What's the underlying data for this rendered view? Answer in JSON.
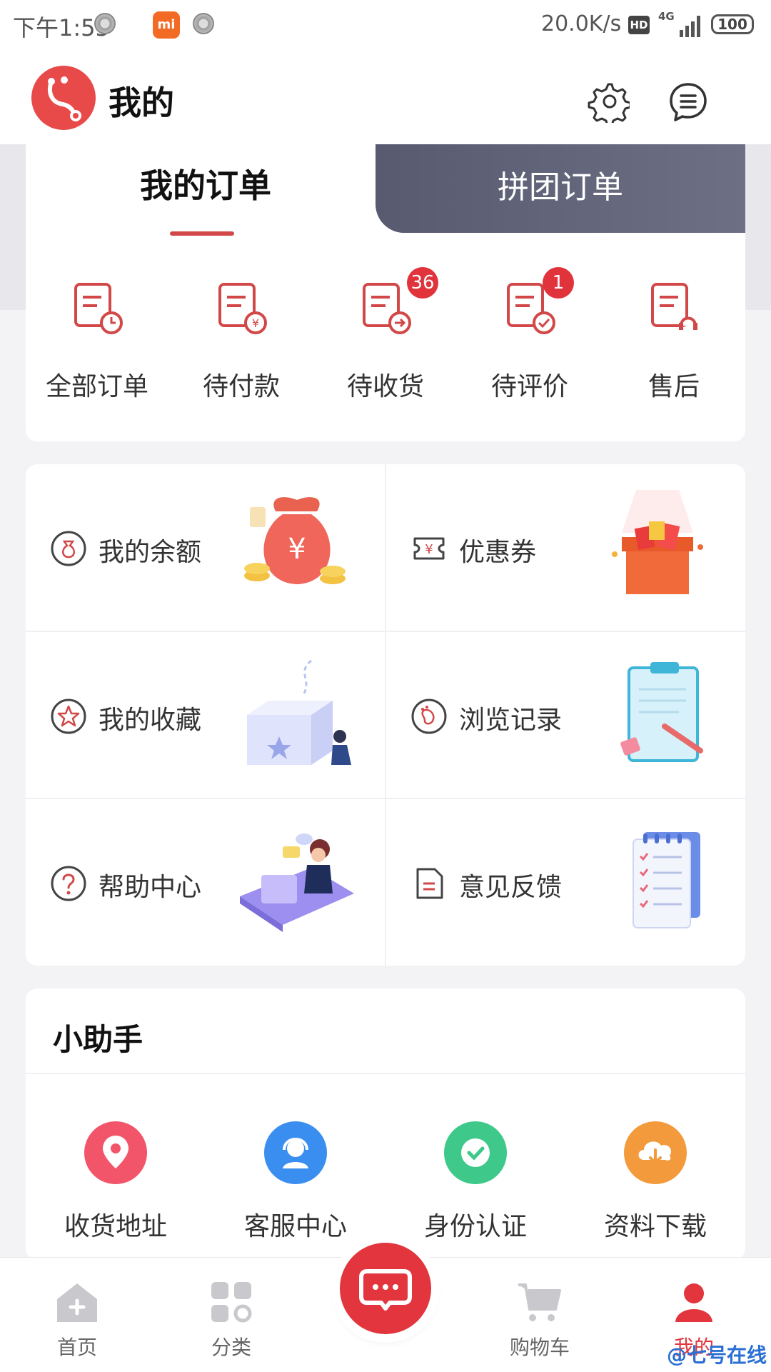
{
  "status_bar": {
    "time": "下午1:55",
    "network_speed": "20.0K/s",
    "hd": "HD",
    "signal_label": "4G",
    "battery": "100",
    "mi_logo": "mi"
  },
  "header": {
    "title": "我的"
  },
  "orders": {
    "tab_active": "我的订单",
    "tab_group": "拼团订单",
    "items": [
      {
        "label": "全部订单",
        "icon": "order-clock-icon",
        "badge": ""
      },
      {
        "label": "待付款",
        "icon": "order-yen-icon",
        "badge": ""
      },
      {
        "label": "待收货",
        "icon": "order-arrow-icon",
        "badge": "36"
      },
      {
        "label": "待评价",
        "icon": "order-check-icon",
        "badge": "1"
      },
      {
        "label": "售后",
        "icon": "order-headset-icon",
        "badge": ""
      }
    ]
  },
  "features": [
    {
      "label": "我的余额",
      "icon": "wallet-icon"
    },
    {
      "label": "优惠券",
      "icon": "coupon-icon"
    },
    {
      "label": "我的收藏",
      "icon": "star-icon"
    },
    {
      "label": "浏览记录",
      "icon": "footprint-icon"
    },
    {
      "label": "帮助中心",
      "icon": "help-icon"
    },
    {
      "label": "意见反馈",
      "icon": "feedback-icon"
    }
  ],
  "helper": {
    "title": "小助手",
    "items": [
      {
        "label": "收货地址",
        "icon": "location-icon",
        "color": "#f2546a"
      },
      {
        "label": "客服中心",
        "icon": "service-icon",
        "color": "#3a8ef0"
      },
      {
        "label": "身份认证",
        "icon": "verify-icon",
        "color": "#3ec98a"
      },
      {
        "label": "资料下载",
        "icon": "download-icon",
        "color": "#f39a3c"
      }
    ]
  },
  "nav": {
    "items": [
      {
        "label": "首页",
        "icon": "home-icon"
      },
      {
        "label": "分类",
        "icon": "category-icon"
      },
      {
        "label": "",
        "icon": "message-icon"
      },
      {
        "label": "购物车",
        "icon": "cart-icon"
      },
      {
        "label": "我的",
        "icon": "user-icon"
      }
    ]
  },
  "watermark": "@七号在线",
  "colors": {
    "accent": "#d24848",
    "badge": "#e0333b",
    "group_tab": "#616379"
  }
}
